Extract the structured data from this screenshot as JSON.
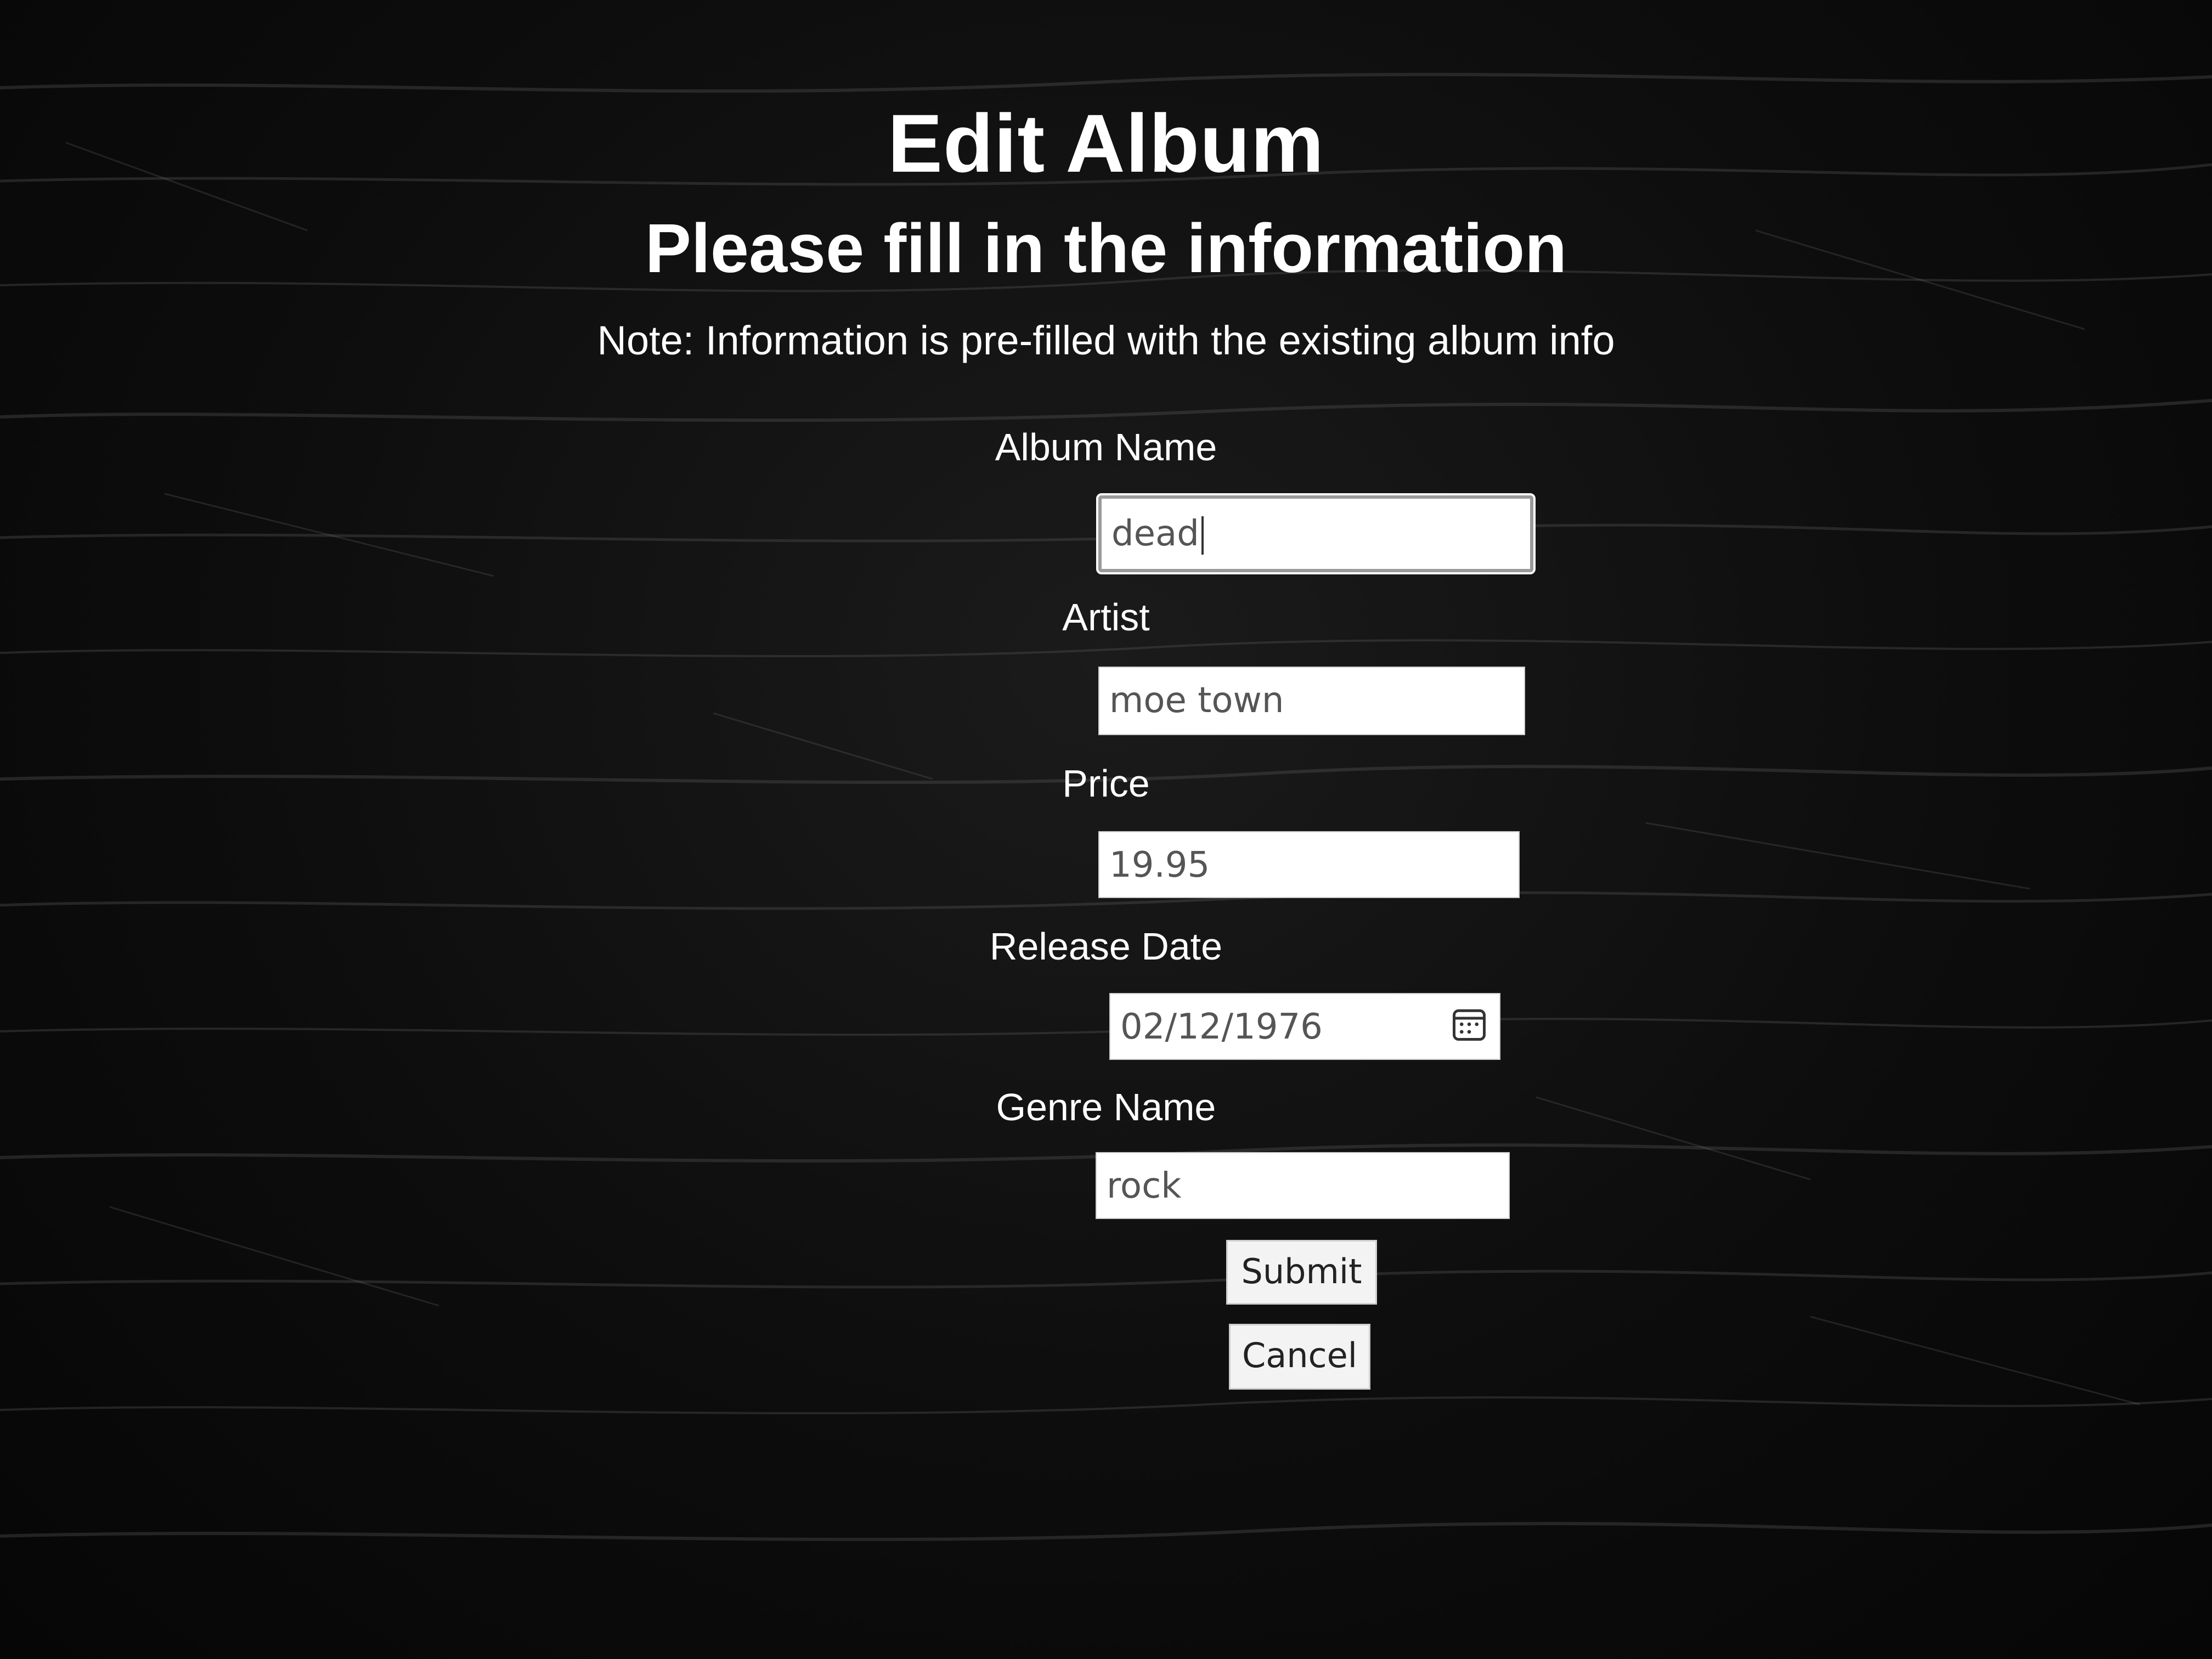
{
  "header": {
    "title": "Edit Album",
    "subtitle": "Please fill in the information",
    "note": "Note: Information is pre-filled with the existing album info"
  },
  "form": {
    "album_name": {
      "label": "Album Name",
      "value": "dead"
    },
    "artist": {
      "label": "Artist",
      "value": "moe town"
    },
    "price": {
      "label": "Price",
      "value": "19.95"
    },
    "release_date": {
      "label": "Release Date",
      "value": "02/12/1976"
    },
    "genre_name": {
      "label": "Genre Name",
      "value": "rock"
    }
  },
  "buttons": {
    "submit": "Submit",
    "cancel": "Cancel"
  },
  "icons": {
    "calendar": "calendar-icon"
  },
  "colors": {
    "background": "#0c0c0c",
    "text": "#ffffff",
    "input_background": "#ffffff",
    "input_text": "#555555"
  }
}
